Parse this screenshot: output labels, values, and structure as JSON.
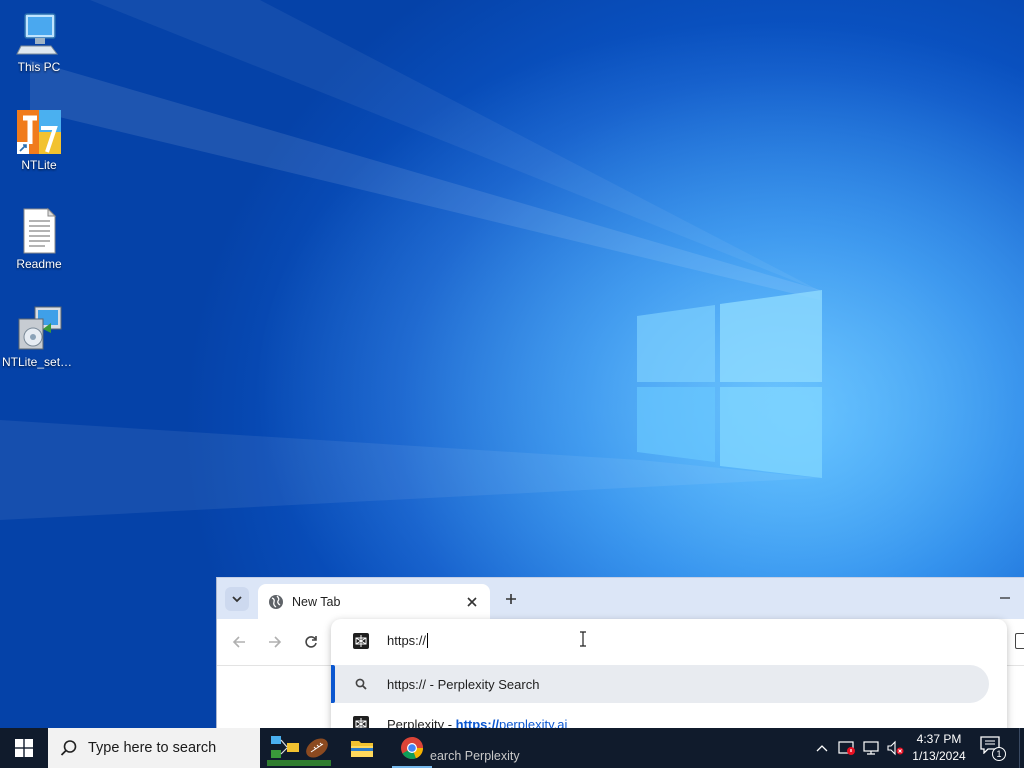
{
  "desktop": {
    "icons": [
      {
        "label": "This PC",
        "icon": "computer-icon"
      },
      {
        "label": "NTLite",
        "icon": "ntlite-icon"
      },
      {
        "label": "Readme",
        "icon": "text-document-icon"
      },
      {
        "label": "NTLite_setu...",
        "icon": "installer-icon"
      }
    ]
  },
  "browser": {
    "tab": {
      "title": "New Tab",
      "icon": "globe-icon"
    },
    "controls": {
      "tab_search": "chevron-down-icon",
      "new_tab": "plus-icon",
      "minimize": "minimize-icon",
      "back": "back-arrow-icon",
      "forward": "forward-arrow-icon",
      "reload": "reload-icon"
    },
    "omnibox": {
      "value": "https://",
      "suggestions": [
        {
          "icon": "search-icon",
          "text": "https:// - Perplexity Search",
          "selected": true
        },
        {
          "icon": "perplexity-icon",
          "site": "Perplexity",
          "separator": " - ",
          "url_bold": "https://",
          "url_rest": "perplexity.ai",
          "selected": false
        }
      ]
    }
  },
  "taskbar": {
    "search_placeholder": "Type here to search",
    "partial_text_behind": "earch Perplexity",
    "clock": {
      "time": "4:37 PM",
      "date": "1/13/2024"
    },
    "notification_count": "1",
    "colors": {
      "background": "#101b2c",
      "accent": "#76b9ed"
    }
  }
}
